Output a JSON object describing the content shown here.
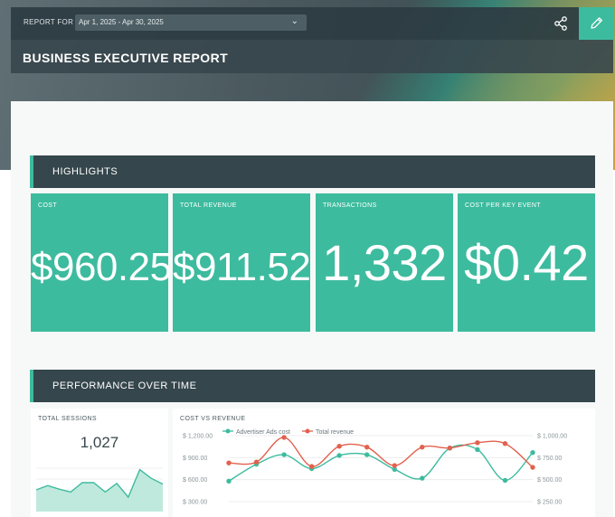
{
  "header": {
    "report_for_label": "REPORT FOR",
    "date_range": "Apr 1, 2025 - Apr 30, 2025",
    "title": "BUSINESS EXECUTIVE REPORT",
    "share_icon": "share-icon",
    "edit_icon": "pencil-icon"
  },
  "colors": {
    "accent": "#3dbb9e",
    "header_dark": "#35464c",
    "cost_series": "#3dbb9e",
    "revenue_series": "#e2614e"
  },
  "highlights": {
    "title": "HIGHLIGHTS",
    "kpis": [
      {
        "label": "COST",
        "value": "$960.25"
      },
      {
        "label": "TOTAL REVENUE",
        "value": "$911.52"
      },
      {
        "label": "TRANSACTIONS",
        "value": "1,332"
      },
      {
        "label": "COST PER KEY EVENT",
        "value": "$0.42"
      }
    ]
  },
  "performance": {
    "title": "PERFORMANCE OVER TIME",
    "sessions": {
      "label": "TOTAL SESSIONS",
      "value": "1,027"
    },
    "cost_vs_revenue": {
      "label": "COST VS REVENUE"
    }
  },
  "chart_data": [
    {
      "type": "area",
      "title": "TOTAL SESSIONS",
      "values": [
        30,
        36,
        31,
        27,
        40,
        40,
        27,
        39,
        20,
        58,
        46,
        38
      ]
    },
    {
      "type": "line",
      "title": "COST VS REVENUE",
      "x": [
        1,
        2,
        3,
        4,
        5,
        6,
        7,
        8,
        9,
        10,
        11,
        12
      ],
      "series": [
        {
          "name": "Advertiser Ads cost",
          "axis": "left",
          "values": [
            580,
            810,
            940,
            750,
            930,
            940,
            740,
            620,
            1030,
            1010,
            590,
            970
          ]
        },
        {
          "name": "Total revenue",
          "axis": "right",
          "values": [
            690,
            700,
            980,
            650,
            880,
            870,
            660,
            870,
            860,
            920,
            910,
            640
          ]
        }
      ],
      "left_axis": {
        "ticks": [
          "$ 1,200.00",
          "$ 900.00",
          "$ 600.00",
          "$ 300.00"
        ],
        "ylim": [
          150,
          1200
        ]
      },
      "right_axis": {
        "ticks": [
          "$ 1,000.00",
          "$ 750.00",
          "$ 500.00",
          "$ 250.00"
        ],
        "ylim": [
          125,
          1000
        ]
      }
    }
  ]
}
